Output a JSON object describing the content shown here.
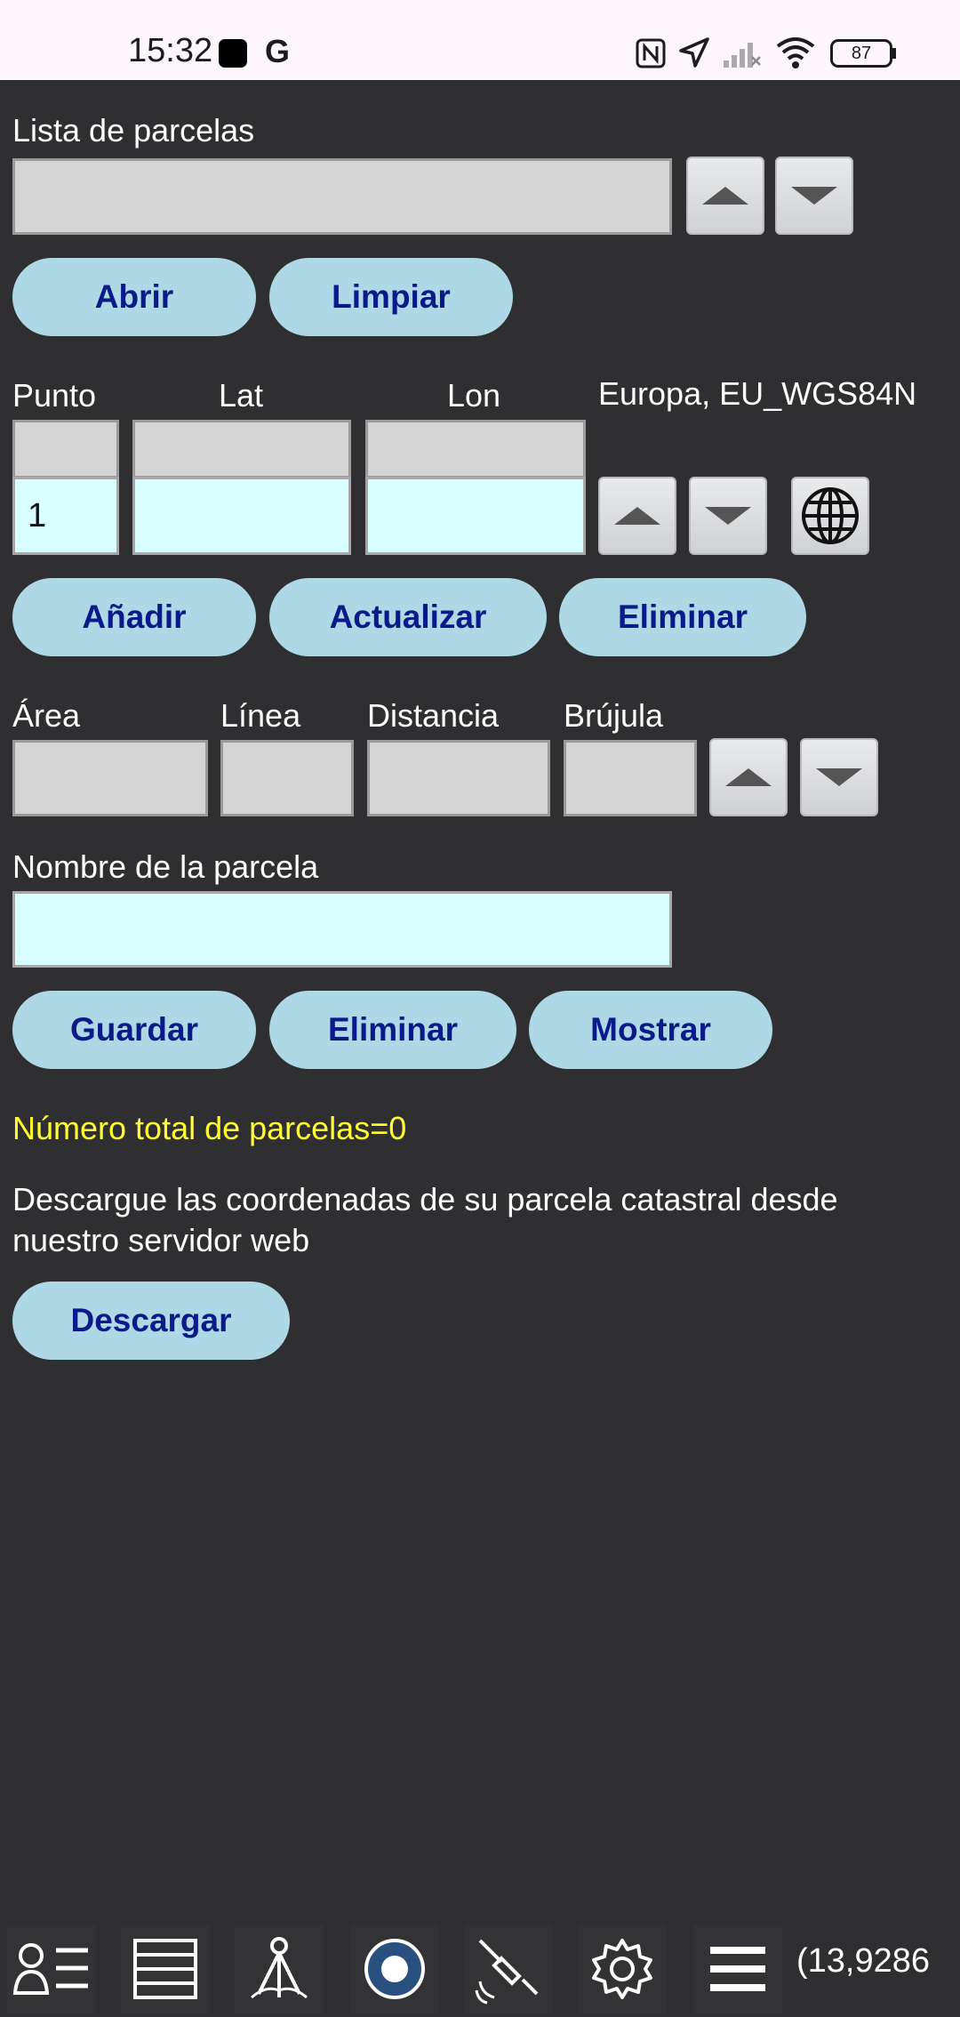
{
  "status_bar": {
    "time": "15:32",
    "battery": "87",
    "icons": [
      "notification-square-icon",
      "google-icon",
      "nfc-icon",
      "location-arrow-icon",
      "signal-icon",
      "wifi-icon",
      "battery-icon"
    ]
  },
  "parcel_list": {
    "label": "Lista de parcelas",
    "value": "",
    "open_label": "Abrir",
    "clear_label": "Limpiar"
  },
  "point_section": {
    "point_label": "Punto",
    "lat_label": "Lat",
    "lon_label": "Lon",
    "datum_label": "Europa, EU_WGS84N",
    "point_value": "1",
    "lat_value": "",
    "lon_value": "",
    "add_label": "Añadir",
    "update_label": "Actualizar",
    "delete_label": "Eliminar"
  },
  "measures": {
    "area_label": "Área",
    "line_label": "Línea",
    "distance_label": "Distancia",
    "compass_label": "Brújula"
  },
  "parcel_name": {
    "label": "Nombre de la parcela",
    "value": "",
    "save_label": "Guardar",
    "delete_label": "Eliminar",
    "show_label": "Mostrar"
  },
  "total_text": "Número total de parcelas=0",
  "download": {
    "description": "Descargue las coordenadas de su parcela catastral desde nuestro servidor web",
    "button_label": "Descargar"
  },
  "bottom_nav": {
    "items": [
      "contacts-list-icon",
      "layers-icon",
      "surveyor-icon",
      "record-icon",
      "satellite-icon",
      "settings-icon",
      "menu-icon"
    ],
    "coordinate": "(13,9286"
  },
  "colors": {
    "background": "#2f2f31",
    "pill_bg": "#aed8e6",
    "pill_text": "#0b1a8a",
    "field_gray": "#d4d4d4",
    "field_cyan": "#d9ffff",
    "highlight": "#ffff33"
  }
}
